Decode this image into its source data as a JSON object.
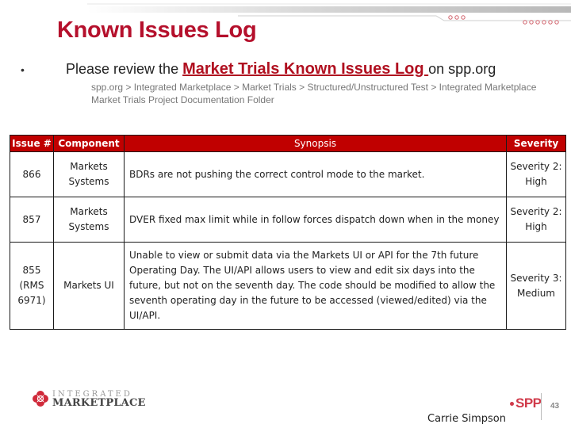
{
  "slide": {
    "title": "Known Issues Log",
    "bullet": {
      "prefix": "Please review the ",
      "link_text": "Market Trials Known Issues Log ",
      "suffix": "on spp.org"
    },
    "navigation_path": "spp.org > Integrated Marketplace > Market Trials >  Structured/Unstructured  Test > Integrated Marketplace Market Trials Project Documentation Folder"
  },
  "table": {
    "headers": [
      "Issue #",
      "Component",
      "Synopsis",
      "Severity"
    ],
    "rows": [
      {
        "issue": "866",
        "component": "Markets Systems",
        "synopsis": "BDRs are not pushing the correct control mode to the market.",
        "severity": "Severity 2: High"
      },
      {
        "issue": "857",
        "component": "Markets Systems",
        "synopsis": "DVER fixed max limit while in follow forces dispatch down when in the money",
        "severity": "Severity 2: High"
      },
      {
        "issue": "855 (RMS 6971)",
        "component": "Markets UI",
        "synopsis": "Unable to view or submit data via the Markets UI or API for the 7th future Operating Day. The UI/API allows users to view and edit six days into the future, but not on the seventh day. The code should be modified to allow the seventh operating day in the future to be accessed (viewed/edited) via the UI/API.",
        "severity": "Severity 3: Medium"
      }
    ]
  },
  "footer": {
    "logo_line1": "INTEGRATED",
    "logo_line2": "MARKETPLACE",
    "presenter": "Carrie Simpson",
    "org_logo": "SPP",
    "page_number": "43"
  },
  "colors": {
    "title": "#b5102c",
    "header_bg": "#c00000",
    "link": "#b01020",
    "accent_logo": "#d03a4a"
  }
}
